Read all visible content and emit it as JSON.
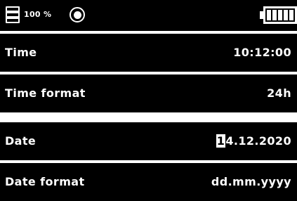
{
  "status": {
    "storage_percent": "100 %",
    "storage_icon": "page-icon",
    "record_icon": "record-icon",
    "battery_icon": "battery-icon",
    "battery_level": 1.0
  },
  "settings": {
    "rows": [
      {
        "label": "Time",
        "value": "10:12:00"
      },
      {
        "label": "Time format",
        "value": "24h"
      },
      {
        "label": "Date",
        "value": "14.12.2020",
        "cursor_char": "1",
        "value_rest": "4.12.2020"
      },
      {
        "label": "Date format",
        "value": "dd.mm.yyyy"
      }
    ]
  },
  "colors": {
    "background": "#000000",
    "foreground": "#ffffff",
    "divider": "#ffffff"
  }
}
